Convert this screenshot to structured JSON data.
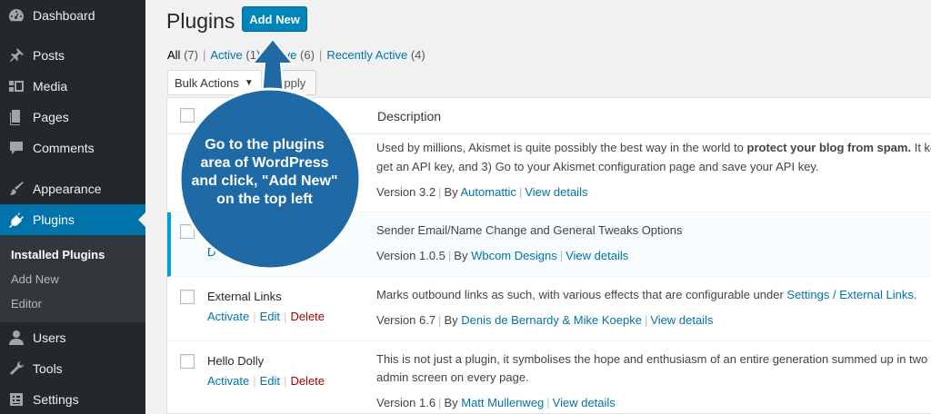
{
  "sidebar": {
    "items": [
      {
        "label": "Dashboard",
        "icon": "dashboard-icon"
      },
      {
        "label": "Posts",
        "icon": "pin-icon"
      },
      {
        "label": "Media",
        "icon": "media-icon"
      },
      {
        "label": "Pages",
        "icon": "pages-icon"
      },
      {
        "label": "Comments",
        "icon": "comment-icon"
      },
      {
        "label": "Appearance",
        "icon": "brush-icon"
      },
      {
        "label": "Plugins",
        "icon": "plug-icon"
      },
      {
        "label": "Users",
        "icon": "user-icon"
      },
      {
        "label": "Tools",
        "icon": "wrench-icon"
      },
      {
        "label": "Settings",
        "icon": "settings-icon"
      }
    ],
    "submenu": [
      "Installed Plugins",
      "Add New",
      "Editor"
    ]
  },
  "header": {
    "title": "Plugins",
    "add_new": "Add New"
  },
  "filters": {
    "all": "All",
    "all_count": "(7)",
    "active": "Active",
    "active_count": "(1)",
    "inactive_visible": "ctive",
    "inactive_count": "(6)",
    "recent": "Recently Active",
    "recent_count": "(4)",
    "sep": "|"
  },
  "bulk": {
    "select": "Bulk Actions",
    "arrow": "▼",
    "apply": "Apply"
  },
  "table": {
    "description_header": "Description",
    "rows": [
      {
        "name": "",
        "desc_line1_a": "Used by millions, Akismet is quite possibly the best way in the world to ",
        "desc_line1_b": "protect your blog from spam.",
        "desc_line1_c": " It ke",
        "desc_line2": "get an API key, and 3) Go to your Akismet configuration page and save your API key.",
        "version": "Version 3.2",
        "by": "By",
        "author": "Automattic",
        "details": "View details"
      },
      {
        "name": "",
        "actions_partial": "D",
        "desc_line1": "Sender Email/Name Change and General Tweaks Options",
        "version": "Version 1.0.5",
        "by": "By",
        "author": "Wbcom Designs",
        "details": "View details"
      },
      {
        "name": "External Links",
        "activate": "Activate",
        "edit": "Edit",
        "delete": "Delete",
        "desc_line1": "Marks outbound links as such, with various effects that are configurable under ",
        "desc_link": "Settings / External Links",
        "desc_end": ".",
        "version": "Version 6.7",
        "by": "By",
        "author": "Denis de Bernardy & Mike Koepke",
        "details": "View details"
      },
      {
        "name": "Hello Dolly",
        "activate": "Activate",
        "edit": "Edit",
        "delete": "Delete",
        "desc_line1": "This is not just a plugin, it symbolises the hope and enthusiasm of an entire generation summed up in two",
        "desc_line2": "admin screen on every page.",
        "version": "Version 1.6",
        "by": "By",
        "author": "Matt Mullenweg",
        "details": "View details"
      }
    ]
  },
  "callout": {
    "lines": [
      "Go to the plugins",
      "area of WordPress",
      "and click, \"Add New\"",
      "on the top left"
    ],
    "color": "#1f6aa5"
  },
  "colors": {
    "sidebar_bg": "#23282d",
    "active_blue": "#0073aa",
    "button_blue": "#0085ba",
    "callout_blue": "#1f6aa5"
  }
}
